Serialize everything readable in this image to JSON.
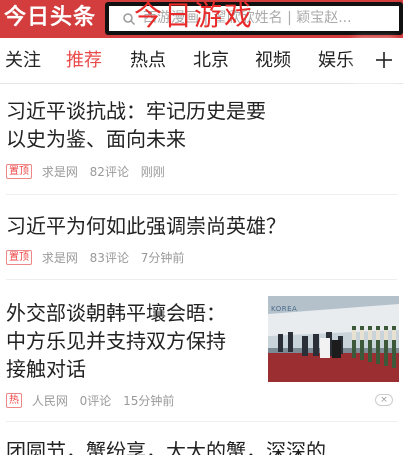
{
  "header": {
    "logo": "今日头条",
    "search_placeholder": "西游漫画 | 翟欣欣姓名 | 颖宝赵...",
    "overlay": "今日游戏"
  },
  "tabs": [
    {
      "label": "关注",
      "active": false
    },
    {
      "label": "推荐",
      "active": true
    },
    {
      "label": "热点",
      "active": false
    },
    {
      "label": "北京",
      "active": false
    },
    {
      "label": "视频",
      "active": false
    },
    {
      "label": "娱乐",
      "active": false
    }
  ],
  "feed": [
    {
      "title": "习近平谈抗战：牢记历史是要以史为鉴、面向未来",
      "title_line1": "习近平谈抗战：牢记历史是要",
      "title_line2": "以史为鉴、面向未来",
      "badge": "置顶",
      "source": "求是网",
      "comments": "82评论",
      "time": "刚刚"
    },
    {
      "title": "习近平为何如此强调崇尚英雄？",
      "badge": "置顶",
      "source": "求是网",
      "comments": "83评论",
      "time": "7分钟前"
    },
    {
      "title_line1": "外交部谈朝韩平壤会晤：",
      "title_line2": "中方乐见并支持双方保持",
      "title_line3": "接触对话",
      "badge": "热",
      "source": "人民网",
      "comments": "0评论",
      "time": "15分钟前",
      "image_text": "KOREA"
    },
    {
      "title_line1": "团圆节，蟹纷享，大大的蟹，深深的"
    }
  ],
  "colors": {
    "brand_red": "#d43d3d",
    "active_tab": "#e94b4b",
    "overlay_red": "#e82a2a"
  }
}
